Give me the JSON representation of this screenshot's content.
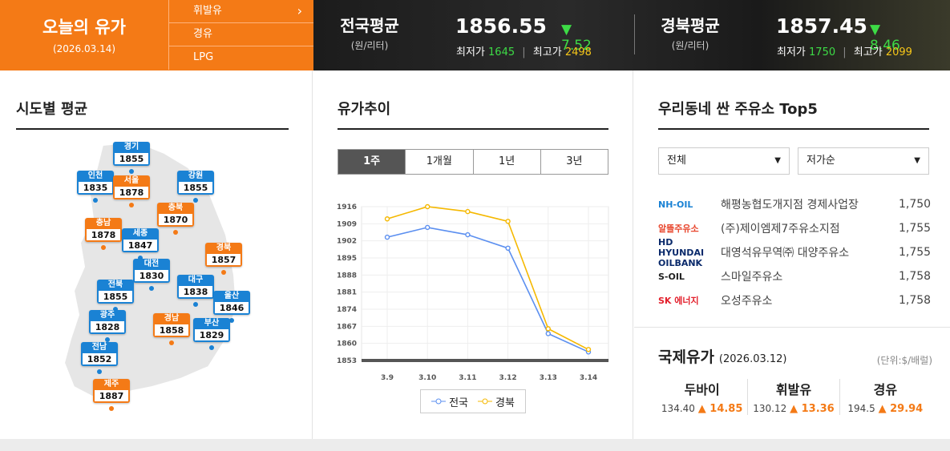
{
  "header": {
    "title": "오늘의 유가",
    "date": "(2026.03.14)",
    "fuel_menu": [
      {
        "label": "휘발유",
        "active": true
      },
      {
        "label": "경유"
      },
      {
        "label": "LPG"
      }
    ],
    "national": {
      "name": "전국평균",
      "unit": "(원/리터)",
      "price": "1856.55",
      "change": "▼ 7.52",
      "min_label": "최저가",
      "min": "1645",
      "max_label": "최고가",
      "max": "2498"
    },
    "regional": {
      "name": "경북평균",
      "unit": "(원/리터)",
      "price": "1857.45",
      "change": "▼ 8.46",
      "min_label": "최저가",
      "min": "1750",
      "max_label": "최고가",
      "max": "2099"
    }
  },
  "regions": {
    "title": "시도별 평균",
    "list": [
      {
        "name": "경기",
        "value": "1855",
        "color": "blue"
      },
      {
        "name": "인천",
        "value": "1835",
        "color": "blue"
      },
      {
        "name": "서울",
        "value": "1878",
        "color": "orange"
      },
      {
        "name": "강원",
        "value": "1855",
        "color": "blue"
      },
      {
        "name": "충북",
        "value": "1870",
        "color": "orange"
      },
      {
        "name": "충남",
        "value": "1878",
        "color": "orange"
      },
      {
        "name": "세종",
        "value": "1847",
        "color": "blue"
      },
      {
        "name": "경북",
        "value": "1857",
        "color": "orange"
      },
      {
        "name": "대전",
        "value": "1830",
        "color": "blue"
      },
      {
        "name": "전북",
        "value": "1855",
        "color": "blue"
      },
      {
        "name": "대구",
        "value": "1838",
        "color": "blue"
      },
      {
        "name": "울산",
        "value": "1846",
        "color": "blue"
      },
      {
        "name": "광주",
        "value": "1828",
        "color": "blue"
      },
      {
        "name": "경남",
        "value": "1858",
        "color": "orange"
      },
      {
        "name": "부산",
        "value": "1829",
        "color": "blue"
      },
      {
        "name": "전남",
        "value": "1852",
        "color": "blue"
      },
      {
        "name": "제주",
        "value": "1887",
        "color": "orange"
      }
    ]
  },
  "trend": {
    "title": "유가추이",
    "tabs": [
      "1주",
      "1개월",
      "1년",
      "3년"
    ],
    "active_tab": 0,
    "legend": [
      "전국",
      "경북"
    ]
  },
  "chart_data": {
    "type": "line",
    "x": [
      "3.9",
      "3.10",
      "3.11",
      "3.12",
      "3.13",
      "3.14"
    ],
    "series": [
      {
        "name": "전국",
        "color": "#5b8ff0",
        "values": [
          1903.5,
          1907.5,
          1904.5,
          1899,
          1864,
          1856.5
        ]
      },
      {
        "name": "경북",
        "color": "#f5b800",
        "values": [
          1911,
          1916,
          1914,
          1910,
          1866,
          1857.5
        ]
      }
    ],
    "yticks": [
      1916,
      1909,
      1902,
      1895,
      1888,
      1881,
      1874,
      1867,
      1860,
      1853
    ],
    "ylim": [
      1853,
      1916
    ],
    "grid": true
  },
  "top5": {
    "title": "우리동네 싼 주유소 Top5",
    "filter": "전체",
    "sort": "저가순",
    "stations": [
      {
        "brand": "NH-OIL",
        "brand_color": "#1a82d4",
        "name": "해평농협도개지점 경제사업장",
        "price": "1,750"
      },
      {
        "brand": "알뜰주유소",
        "brand_color": "#e8452c",
        "name": "(주)제이엠제7주유소지점",
        "price": "1,755"
      },
      {
        "brand": "HD HYUNDAI OILBANK",
        "brand_color": "#0a2a6b",
        "name": "대영석유무역㈜ 대양주유소",
        "price": "1,755"
      },
      {
        "brand": "S-OIL",
        "brand_color": "#222",
        "name": "스마일주유소",
        "price": "1,758"
      },
      {
        "brand": "SK 에너지",
        "brand_color": "#e3202c",
        "name": "오성주유소",
        "price": "1,758"
      }
    ]
  },
  "intl": {
    "title": "국제유가",
    "date": "(2026.03.12)",
    "unit": "(단위:$/배럴)",
    "items": [
      {
        "name": "두바이",
        "price": "134.40",
        "change": "▲ 14.85"
      },
      {
        "name": "휘발유",
        "price": "130.12",
        "change": "▲ 13.36"
      },
      {
        "name": "경유",
        "price": "194.5",
        "change": "▲ 29.94"
      }
    ]
  }
}
